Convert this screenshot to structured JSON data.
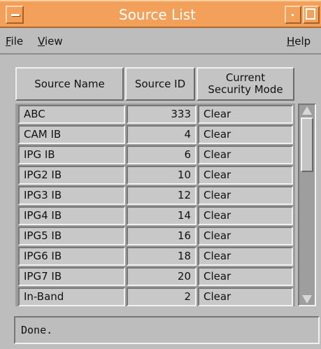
{
  "window": {
    "title": "Source List"
  },
  "menubar": {
    "file": "File",
    "view": "View",
    "help": "Help"
  },
  "table": {
    "headers": {
      "name": "Source Name",
      "id": "Source ID",
      "mode_line1": "Current",
      "mode_line2": "Security Mode"
    },
    "rows": [
      {
        "name": "ABC",
        "id": "333",
        "mode": "Clear"
      },
      {
        "name": "CAM IB",
        "id": "4",
        "mode": "Clear"
      },
      {
        "name": "IPG IB",
        "id": "6",
        "mode": "Clear"
      },
      {
        "name": "IPG2 IB",
        "id": "10",
        "mode": "Clear"
      },
      {
        "name": "IPG3 IB",
        "id": "12",
        "mode": "Clear"
      },
      {
        "name": "IPG4 IB",
        "id": "14",
        "mode": "Clear"
      },
      {
        "name": "IPG5 IB",
        "id": "16",
        "mode": "Clear"
      },
      {
        "name": "IPG6 IB",
        "id": "18",
        "mode": "Clear"
      },
      {
        "name": "IPG7 IB",
        "id": "20",
        "mode": "Clear"
      },
      {
        "name": "In-Band",
        "id": "2",
        "mode": "Clear"
      }
    ]
  },
  "status": {
    "text": "Done."
  },
  "icons": {
    "window_menu": "window-menu-icon",
    "minimize": "minimize-icon",
    "maximize": "maximize-icon",
    "scroll_up": "scroll-up-arrow-icon",
    "scroll_down": "scroll-down-arrow-icon"
  },
  "colors": {
    "titlebar": "#f2a05a",
    "background": "#bdbdbd"
  }
}
